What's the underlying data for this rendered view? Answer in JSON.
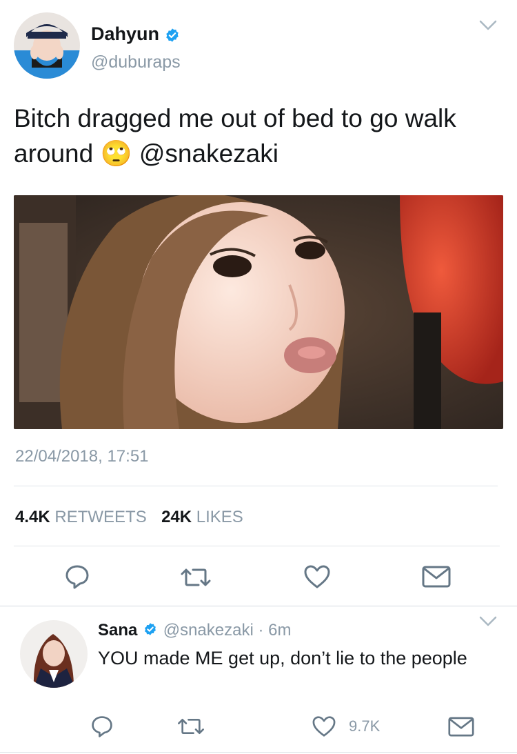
{
  "main_tweet": {
    "display_name": "Dahyun",
    "handle": "@duburaps",
    "text": "Bitch dragged me out of bed to go walk around",
    "emoji": "🙄",
    "mention": "@snakezaki",
    "timestamp": "22/04/2018, 17:51",
    "retweets_count": "4.4K",
    "retweets_label": "RETWEETS",
    "likes_count": "24K",
    "likes_label": "LIKES"
  },
  "reply_tweet": {
    "display_name": "Sana",
    "handle": "@snakezaki",
    "separator": "·",
    "time": "6m",
    "text": "YOU made ME get up, don’t lie to the people",
    "like_count": "9.7K"
  },
  "colors": {
    "verified": "#1da1f2",
    "icon_gray": "#657786",
    "muted_text": "#8a99a6"
  }
}
